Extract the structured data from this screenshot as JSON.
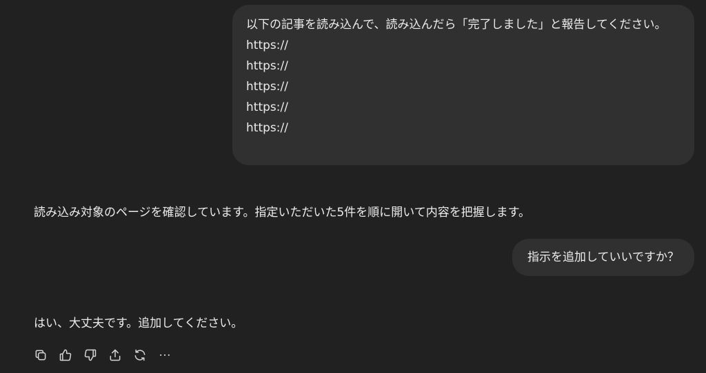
{
  "conversation": {
    "user_message_1": {
      "lines": [
        "以下の記事を読み込んで、読み込んだら「完了しました」と報告してください。",
        "https://",
        "https://",
        "https://",
        "https://",
        "https://"
      ]
    },
    "assistant_message_1": "読み込み対象のページを確認しています。指定いただいた5件を順に開いて内容を把握します。",
    "user_message_2": "指示を追加していいですか？",
    "assistant_message_2": "はい、大丈夫です。追加してください。"
  },
  "actions": [
    {
      "name": "copy",
      "icon": "copy-icon"
    },
    {
      "name": "good-response",
      "icon": "thumbs-up-icon"
    },
    {
      "name": "bad-response",
      "icon": "thumbs-down-icon"
    },
    {
      "name": "share",
      "icon": "share-icon"
    },
    {
      "name": "regenerate",
      "icon": "refresh-icon"
    },
    {
      "name": "more",
      "icon": "more-horizontal-icon"
    }
  ]
}
